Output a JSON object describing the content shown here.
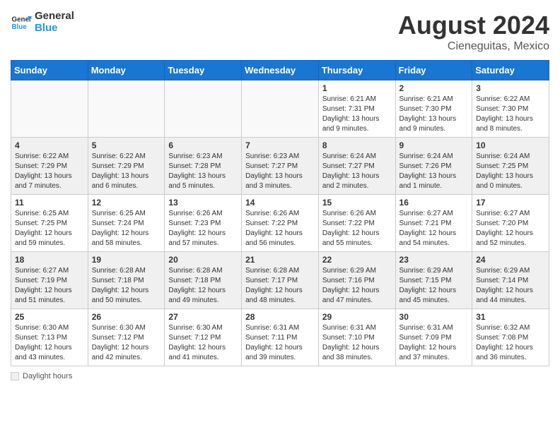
{
  "header": {
    "logo_text_general": "General",
    "logo_text_blue": "Blue",
    "month_year": "August 2024",
    "location": "Cieneguitas, Mexico"
  },
  "footer": {
    "daylight_label": "Daylight hours"
  },
  "days_of_week": [
    "Sunday",
    "Monday",
    "Tuesday",
    "Wednesday",
    "Thursday",
    "Friday",
    "Saturday"
  ],
  "weeks": [
    [
      {
        "num": "",
        "info": "",
        "empty": true
      },
      {
        "num": "",
        "info": "",
        "empty": true
      },
      {
        "num": "",
        "info": "",
        "empty": true
      },
      {
        "num": "",
        "info": "",
        "empty": true
      },
      {
        "num": "1",
        "info": "Sunrise: 6:21 AM\nSunset: 7:31 PM\nDaylight: 13 hours\nand 9 minutes."
      },
      {
        "num": "2",
        "info": "Sunrise: 6:21 AM\nSunset: 7:30 PM\nDaylight: 13 hours\nand 9 minutes."
      },
      {
        "num": "3",
        "info": "Sunrise: 6:22 AM\nSunset: 7:30 PM\nDaylight: 13 hours\nand 8 minutes."
      }
    ],
    [
      {
        "num": "4",
        "info": "Sunrise: 6:22 AM\nSunset: 7:29 PM\nDaylight: 13 hours\nand 7 minutes.",
        "shaded": true
      },
      {
        "num": "5",
        "info": "Sunrise: 6:22 AM\nSunset: 7:29 PM\nDaylight: 13 hours\nand 6 minutes.",
        "shaded": true
      },
      {
        "num": "6",
        "info": "Sunrise: 6:23 AM\nSunset: 7:28 PM\nDaylight: 13 hours\nand 5 minutes.",
        "shaded": true
      },
      {
        "num": "7",
        "info": "Sunrise: 6:23 AM\nSunset: 7:27 PM\nDaylight: 13 hours\nand 3 minutes.",
        "shaded": true
      },
      {
        "num": "8",
        "info": "Sunrise: 6:24 AM\nSunset: 7:27 PM\nDaylight: 13 hours\nand 2 minutes.",
        "shaded": true
      },
      {
        "num": "9",
        "info": "Sunrise: 6:24 AM\nSunset: 7:26 PM\nDaylight: 13 hours\nand 1 minute.",
        "shaded": true
      },
      {
        "num": "10",
        "info": "Sunrise: 6:24 AM\nSunset: 7:25 PM\nDaylight: 13 hours\nand 0 minutes.",
        "shaded": true
      }
    ],
    [
      {
        "num": "11",
        "info": "Sunrise: 6:25 AM\nSunset: 7:25 PM\nDaylight: 12 hours\nand 59 minutes."
      },
      {
        "num": "12",
        "info": "Sunrise: 6:25 AM\nSunset: 7:24 PM\nDaylight: 12 hours\nand 58 minutes."
      },
      {
        "num": "13",
        "info": "Sunrise: 6:26 AM\nSunset: 7:23 PM\nDaylight: 12 hours\nand 57 minutes."
      },
      {
        "num": "14",
        "info": "Sunrise: 6:26 AM\nSunset: 7:22 PM\nDaylight: 12 hours\nand 56 minutes."
      },
      {
        "num": "15",
        "info": "Sunrise: 6:26 AM\nSunset: 7:22 PM\nDaylight: 12 hours\nand 55 minutes."
      },
      {
        "num": "16",
        "info": "Sunrise: 6:27 AM\nSunset: 7:21 PM\nDaylight: 12 hours\nand 54 minutes."
      },
      {
        "num": "17",
        "info": "Sunrise: 6:27 AM\nSunset: 7:20 PM\nDaylight: 12 hours\nand 52 minutes."
      }
    ],
    [
      {
        "num": "18",
        "info": "Sunrise: 6:27 AM\nSunset: 7:19 PM\nDaylight: 12 hours\nand 51 minutes.",
        "shaded": true
      },
      {
        "num": "19",
        "info": "Sunrise: 6:28 AM\nSunset: 7:18 PM\nDaylight: 12 hours\nand 50 minutes.",
        "shaded": true
      },
      {
        "num": "20",
        "info": "Sunrise: 6:28 AM\nSunset: 7:18 PM\nDaylight: 12 hours\nand 49 minutes.",
        "shaded": true
      },
      {
        "num": "21",
        "info": "Sunrise: 6:28 AM\nSunset: 7:17 PM\nDaylight: 12 hours\nand 48 minutes.",
        "shaded": true
      },
      {
        "num": "22",
        "info": "Sunrise: 6:29 AM\nSunset: 7:16 PM\nDaylight: 12 hours\nand 47 minutes.",
        "shaded": true
      },
      {
        "num": "23",
        "info": "Sunrise: 6:29 AM\nSunset: 7:15 PM\nDaylight: 12 hours\nand 45 minutes.",
        "shaded": true
      },
      {
        "num": "24",
        "info": "Sunrise: 6:29 AM\nSunset: 7:14 PM\nDaylight: 12 hours\nand 44 minutes.",
        "shaded": true
      }
    ],
    [
      {
        "num": "25",
        "info": "Sunrise: 6:30 AM\nSunset: 7:13 PM\nDaylight: 12 hours\nand 43 minutes."
      },
      {
        "num": "26",
        "info": "Sunrise: 6:30 AM\nSunset: 7:12 PM\nDaylight: 12 hours\nand 42 minutes."
      },
      {
        "num": "27",
        "info": "Sunrise: 6:30 AM\nSunset: 7:12 PM\nDaylight: 12 hours\nand 41 minutes."
      },
      {
        "num": "28",
        "info": "Sunrise: 6:31 AM\nSunset: 7:11 PM\nDaylight: 12 hours\nand 39 minutes."
      },
      {
        "num": "29",
        "info": "Sunrise: 6:31 AM\nSunset: 7:10 PM\nDaylight: 12 hours\nand 38 minutes."
      },
      {
        "num": "30",
        "info": "Sunrise: 6:31 AM\nSunset: 7:09 PM\nDaylight: 12 hours\nand 37 minutes."
      },
      {
        "num": "31",
        "info": "Sunrise: 6:32 AM\nSunset: 7:08 PM\nDaylight: 12 hours\nand 36 minutes."
      }
    ]
  ]
}
